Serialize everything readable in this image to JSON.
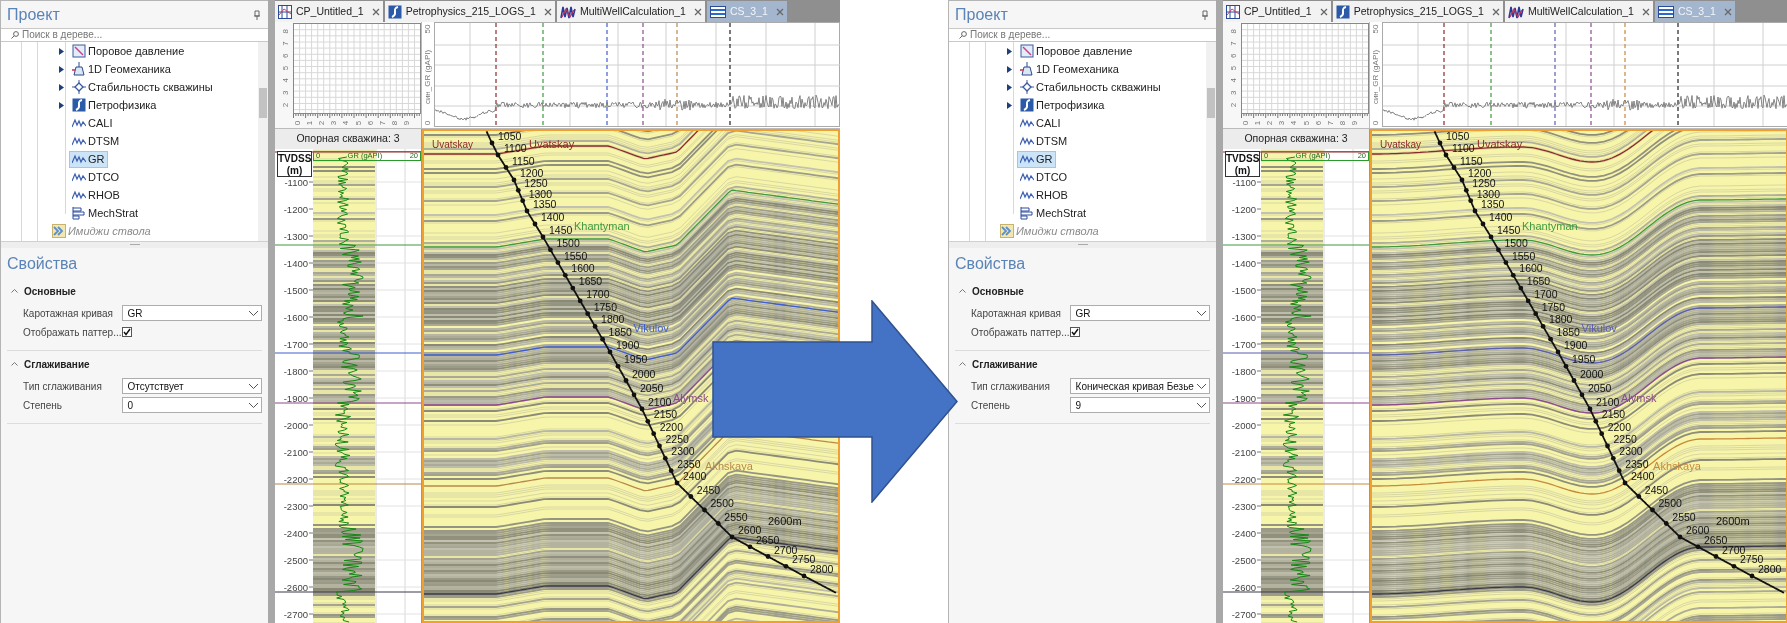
{
  "screens": [
    {
      "panel": {
        "title": "Проект",
        "search": {
          "placeholder": "Поиск в дереве..."
        },
        "tree": [
          {
            "children": [
              {
                "label": "Поровое давление",
                "kind": "pressure",
                "expanded": false,
                "selected": false,
                "disabled": false
              },
              {
                "label": "1D Геомеханика",
                "kind": "geomechanics",
                "expanded": false,
                "selected": false,
                "disabled": false
              },
              {
                "label": "Стабильность скважины",
                "kind": "stability",
                "expanded": false,
                "selected": false,
                "disabled": false
              },
              {
                "label": "Петрофизика",
                "kind": "petrophysics",
                "expanded": false,
                "selected": false,
                "disabled": false
              },
              {
                "label": "CALI",
                "kind": "log",
                "selected": false,
                "disabled": false
              },
              {
                "label": "DTSM",
                "kind": "log",
                "selected": false,
                "disabled": false
              },
              {
                "label": "GR",
                "kind": "log",
                "selected": true,
                "disabled": false
              },
              {
                "label": "DTCO",
                "kind": "log",
                "selected": false,
                "disabled": false
              },
              {
                "label": "RHOB",
                "kind": "log",
                "selected": false,
                "disabled": false
              },
              {
                "label": "MechStrat",
                "kind": "strat",
                "selected": false,
                "disabled": false
              }
            ]
          },
          {
            "label": "Имиджи ствола",
            "kind": "images",
            "selected": false,
            "disabled": true
          }
        ],
        "properties": {
          "title": "Свойства",
          "groups": [
            {
              "title": "Основные",
              "expanded": true,
              "rows": [
                {
                  "kind": "dropdown",
                  "label": "Каротажная кривая",
                  "value": "GR"
                },
                {
                  "kind": "checkbox",
                  "label": "Отображать паттер...",
                  "checked": true
                }
              ]
            },
            {
              "title": "Сглаживание",
              "expanded": true,
              "rows": [
                {
                  "kind": "dropdown",
                  "label": "Тип сглаживания",
                  "value": "Отсутствует"
                },
                {
                  "kind": "dropdown",
                  "label": "Степень",
                  "value": "0"
                }
              ]
            }
          ]
        }
      },
      "tabs": [
        {
          "label": "CP_Untitled_1",
          "kind": "crossplot",
          "selected": false
        },
        {
          "label": "Petrophysics_215_LOGS_1",
          "kind": "petrophysics",
          "selected": false
        },
        {
          "label": "MultiWellCalculation_1",
          "kind": "multiwell",
          "selected": false
        },
        {
          "label": "CS_3_1",
          "kind": "section",
          "selected": true
        }
      ],
      "crossplot": {
        "xticks": [
          "0",
          "1",
          "2",
          "3",
          "4",
          "5",
          "6",
          "7",
          "8",
          "9"
        ],
        "yticks": [
          "2",
          "3",
          "4",
          "5",
          "6",
          "7",
          "8"
        ]
      },
      "log_chart": {
        "ylabel": "син_GR (gAPI)",
        "ymin": "0",
        "ymax": "50"
      },
      "well_track": {
        "title": "Опорная скважина: 3",
        "depth_header": "TVDSS (m)",
        "curve": {
          "name": "GR (gAPI)",
          "min": "0",
          "max": "20"
        },
        "depth_ticks": [
          "-1100",
          "-1200",
          "-1300",
          "-1400",
          "-1500",
          "-1600",
          "-1700",
          "-1800",
          "-1900",
          "-2000",
          "-2100",
          "-2200",
          "-2300",
          "-2400",
          "-2500",
          "-2600",
          "-2700"
        ]
      },
      "section": {
        "smoothed": false,
        "edge_label": "Uvatskay",
        "formations": [
          {
            "name": "Uvatskay",
            "color": "#8b2a2a"
          },
          {
            "name": "Khantyman",
            "color": "#3f9a3f"
          },
          {
            "name": "Vikulov",
            "color": "#3f5fd0"
          },
          {
            "name": "Alymsk",
            "color": "#8e4a8e"
          },
          {
            "name": "Akhskaya",
            "color": "#b8894a"
          }
        ],
        "marks": [
          "1050",
          "1100",
          "1150",
          "1200",
          "1250",
          "1300",
          "1350",
          "1400",
          "1450",
          "1500",
          "1550",
          "1600",
          "1650",
          "1700",
          "1750",
          "1800",
          "1850",
          "1900",
          "1950",
          "2000",
          "2050",
          "2100",
          "2150",
          "2200",
          "2250",
          "2300",
          "2350",
          "2400",
          "2450",
          "2500",
          "2550",
          "2600",
          "2650",
          "2700",
          "2750",
          "2800"
        ],
        "td_label": "2600m"
      }
    },
    {
      "panel": {
        "title": "Проект",
        "search": {
          "placeholder": "Поиск в дереве..."
        },
        "tree": [
          {
            "children": [
              {
                "label": "Поровое давление",
                "kind": "pressure",
                "expanded": false,
                "selected": false,
                "disabled": false
              },
              {
                "label": "1D Геомеханика",
                "kind": "geomechanics",
                "expanded": false,
                "selected": false,
                "disabled": false
              },
              {
                "label": "Стабильность скважины",
                "kind": "stability",
                "expanded": false,
                "selected": false,
                "disabled": false
              },
              {
                "label": "Петрофизика",
                "kind": "petrophysics",
                "expanded": false,
                "selected": false,
                "disabled": false
              },
              {
                "label": "CALI",
                "kind": "log",
                "selected": false,
                "disabled": false
              },
              {
                "label": "DTSM",
                "kind": "log",
                "selected": false,
                "disabled": false
              },
              {
                "label": "GR",
                "kind": "log",
                "selected": true,
                "disabled": false
              },
              {
                "label": "DTCO",
                "kind": "log",
                "selected": false,
                "disabled": false
              },
              {
                "label": "RHOB",
                "kind": "log",
                "selected": false,
                "disabled": false
              },
              {
                "label": "MechStrat",
                "kind": "strat",
                "selected": false,
                "disabled": false
              }
            ]
          },
          {
            "label": "Имиджи ствола",
            "kind": "images",
            "selected": false,
            "disabled": true
          }
        ],
        "properties": {
          "title": "Свойства",
          "groups": [
            {
              "title": "Основные",
              "expanded": true,
              "rows": [
                {
                  "kind": "dropdown",
                  "label": "Каротажная кривая",
                  "value": "GR"
                },
                {
                  "kind": "checkbox",
                  "label": "Отображать паттер...",
                  "checked": true
                }
              ]
            },
            {
              "title": "Сглаживание",
              "expanded": true,
              "rows": [
                {
                  "kind": "dropdown",
                  "label": "Тип сглаживания",
                  "value": "Коническая кривая Безье"
                },
                {
                  "kind": "dropdown",
                  "label": "Степень",
                  "value": "9"
                }
              ]
            }
          ]
        }
      },
      "tabs": [
        {
          "label": "CP_Untitled_1",
          "kind": "crossplot",
          "selected": false
        },
        {
          "label": "Petrophysics_215_LOGS_1",
          "kind": "petrophysics",
          "selected": false
        },
        {
          "label": "MultiWellCalculation_1",
          "kind": "multiwell",
          "selected": false
        },
        {
          "label": "CS_3_1",
          "kind": "section",
          "selected": true
        }
      ],
      "crossplot": {
        "xticks": [
          "0",
          "1",
          "2",
          "3",
          "4",
          "5",
          "6",
          "7",
          "8",
          "9"
        ],
        "yticks": [
          "2",
          "3",
          "4",
          "5",
          "6",
          "7",
          "8"
        ]
      },
      "log_chart": {
        "ylabel": "син_GR (gAPI)",
        "ymin": "0",
        "ymax": "50"
      },
      "well_track": {
        "title": "Опорная скважина: 3",
        "depth_header": "TVDSS (m)",
        "curve": {
          "name": "GR (gAPI)",
          "min": "0",
          "max": "20"
        },
        "depth_ticks": [
          "-1100",
          "-1200",
          "-1300",
          "-1400",
          "-1500",
          "-1600",
          "-1700",
          "-1800",
          "-1900",
          "-2000",
          "-2100",
          "-2200",
          "-2300",
          "-2400",
          "-2500",
          "-2600",
          "-2700"
        ]
      },
      "section": {
        "smoothed": true,
        "edge_label": "Uvatskay",
        "formations": [
          {
            "name": "Uvatskay",
            "color": "#8b2a2a"
          },
          {
            "name": "Khantyman",
            "color": "#3f9a3f"
          },
          {
            "name": "Vikulov",
            "color": "#5a5fb0"
          },
          {
            "name": "Alymsk",
            "color": "#8e4a8e"
          },
          {
            "name": "Akhskaya",
            "color": "#c8893a"
          }
        ],
        "marks": [
          "1050",
          "1100",
          "1150",
          "1200",
          "1250",
          "1300",
          "1350",
          "1400",
          "1450",
          "1500",
          "1550",
          "1600",
          "1650",
          "1700",
          "1750",
          "1800",
          "1850",
          "1900",
          "1950",
          "2000",
          "2050",
          "2100",
          "2150",
          "2200",
          "2250",
          "2300",
          "2350",
          "2400",
          "2450",
          "2500",
          "2550",
          "2600",
          "2650",
          "2700",
          "2750",
          "2800"
        ],
        "td_label": "2600m"
      }
    }
  ]
}
